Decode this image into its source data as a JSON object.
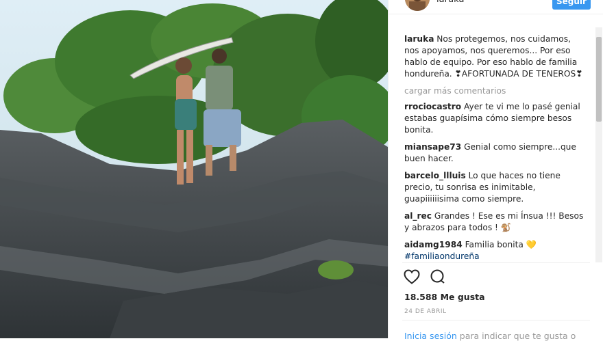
{
  "header": {
    "username": "laruka",
    "follow_label": "Seguir"
  },
  "comments": [
    {
      "user": "laruka",
      "text": "Nos protegemos, nos cuidamos, nos apoyamos, nos queremos... Por eso hablo de equipo. Por eso hablo de familia hondureña. ❣AFORTUNADA DE TENEROS❣"
    },
    {
      "user": "rrociocastro",
      "text": "Ayer te vi me lo pasé genial estabas guapísima cómo siempre besos bonita."
    },
    {
      "user": "miansape73",
      "text": "Genial como siempre...que buen hacer."
    },
    {
      "user": "barcelo_llluis",
      "text": "Lo que haces no tiene precio, tu sonrisa es inimitable, guapiiiiiisima como siempre."
    },
    {
      "user": "al_rec",
      "text": "Grandes ! Ese es mi Ínsua !!! Besos y abrazos para todos ! 🐒"
    },
    {
      "user": "aidamg1984",
      "text": "Familia bonita 💛",
      "hashtag": "#familiaondureña"
    }
  ],
  "load_more_label": "cargar más comentarios",
  "likes": "18.588 Me gusta",
  "date": "24 DE ABRIL",
  "login": {
    "link": "Inicia sesión",
    "text": " para indicar que te gusta o"
  },
  "icons": {
    "like": "heart-icon",
    "comment": "comment-icon"
  }
}
